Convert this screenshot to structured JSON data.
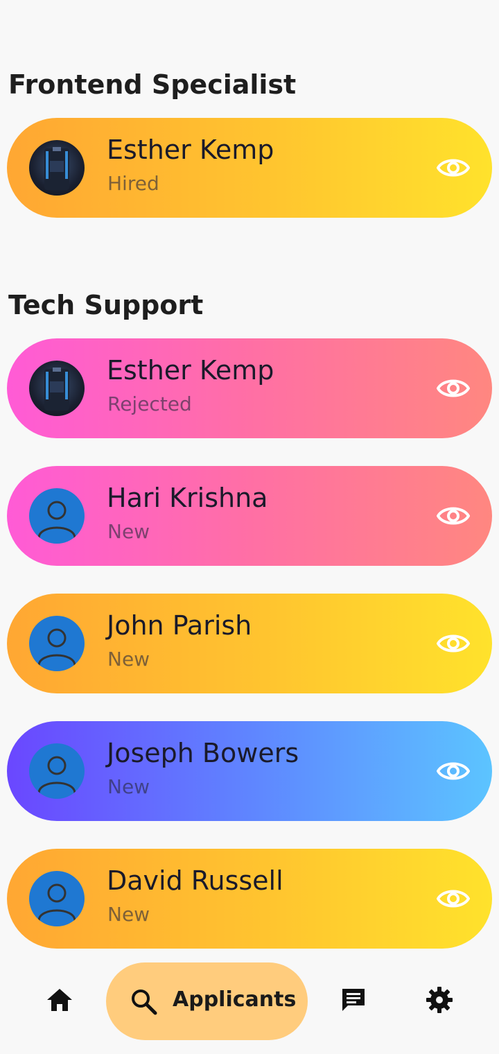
{
  "status_bar": {
    "left_text": "",
    "right_text": ""
  },
  "sections": [
    {
      "title": "Frontend Specialist",
      "applicants": [
        {
          "name": "Esther Kemp",
          "status": "Hired",
          "avatar": "photo"
        }
      ]
    },
    {
      "title": "Tech Support",
      "applicants": [
        {
          "name": "Esther Kemp",
          "status": "Rejected",
          "avatar": "photo"
        },
        {
          "name": "Hari Krishna",
          "status": "New",
          "avatar": "person-icon"
        },
        {
          "name": "John Parish",
          "status": "New",
          "avatar": "person-icon"
        },
        {
          "name": "Joseph Bowers",
          "status": "New",
          "avatar": "person-icon"
        },
        {
          "name": "David Russell",
          "status": "New",
          "avatar": "person-icon"
        }
      ]
    }
  ],
  "colors": {
    "orange_gradient": [
      "#ffa733",
      "#ffe22c"
    ],
    "pink_gradient": [
      "#ff5bd6",
      "#ff8780"
    ],
    "blue_gradient": [
      "#6a47ff",
      "#5cc4ff"
    ],
    "avatar_blue": "#1f78d2",
    "nav_active": "#ffcc7d"
  },
  "bottom_nav": {
    "items": [
      {
        "icon": "home-icon"
      },
      {
        "icon": "search-icon",
        "label": "Applicants",
        "active": true
      },
      {
        "icon": "message-icon"
      },
      {
        "icon": "gear-icon"
      }
    ]
  }
}
